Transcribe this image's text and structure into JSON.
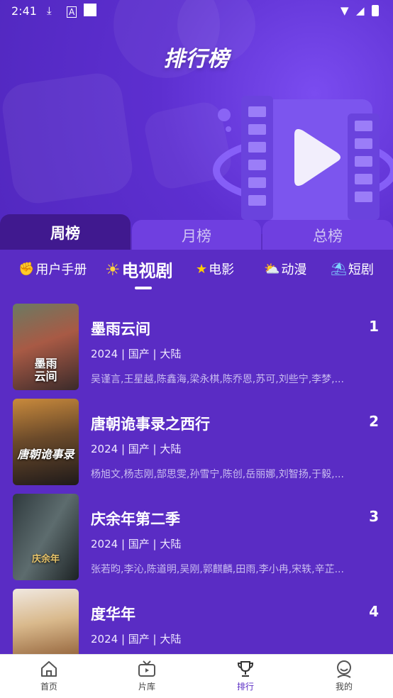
{
  "status_bar": {
    "time": "2:41"
  },
  "header": {
    "title": "排行榜"
  },
  "tabs": [
    {
      "label": "周榜",
      "active": true
    },
    {
      "label": "月榜",
      "active": false
    },
    {
      "label": "总榜",
      "active": false
    }
  ],
  "categories": [
    {
      "icon": "✊",
      "label": "用户手册",
      "active": false
    },
    {
      "icon": "☀",
      "label": "电视剧",
      "active": true
    },
    {
      "icon": "★",
      "label": "电影",
      "active": false
    },
    {
      "icon": "⛅",
      "label": "动漫",
      "active": false
    },
    {
      "icon": "⛱",
      "label": "短剧",
      "active": false
    }
  ],
  "items": [
    {
      "rank": "1",
      "title": "墨雨云间",
      "meta": "2024 | 国产 | 大陆",
      "cast": "吴谨言,王星越,陈鑫海,梁永棋,陈乔恩,苏可,刘些宁,李梦,...",
      "poster_text": "墨雨\n云间"
    },
    {
      "rank": "2",
      "title": "唐朝诡事录之西行",
      "meta": "2024 | 国产 | 大陆",
      "cast": "杨旭文,杨志刚,郜思雯,孙雪宁,陈创,岳丽娜,刘智扬,于毅,...",
      "poster_text": "唐朝诡事录"
    },
    {
      "rank": "3",
      "title": "庆余年第二季",
      "meta": "2024 | 国产 | 大陆",
      "cast": "张若昀,李沁,陈道明,吴刚,郭麒麟,田雨,李小冉,宋轶,辛芷...",
      "poster_text": "庆余年"
    },
    {
      "rank": "4",
      "title": "度华年",
      "meta": "2024 | 国产 | 大陆",
      "cast": "",
      "poster_text": ""
    }
  ],
  "bottom_nav": [
    {
      "label": "首页",
      "icon": "home-icon",
      "active": false
    },
    {
      "label": "片库",
      "icon": "tv-icon",
      "active": false
    },
    {
      "label": "排行",
      "icon": "trophy-icon",
      "active": true
    },
    {
      "label": "我的",
      "icon": "user-icon",
      "active": false
    }
  ],
  "colors": {
    "primary": "#5a2cc4",
    "tab_active": "#40198f",
    "tab_inactive": "#6f3fe0"
  }
}
